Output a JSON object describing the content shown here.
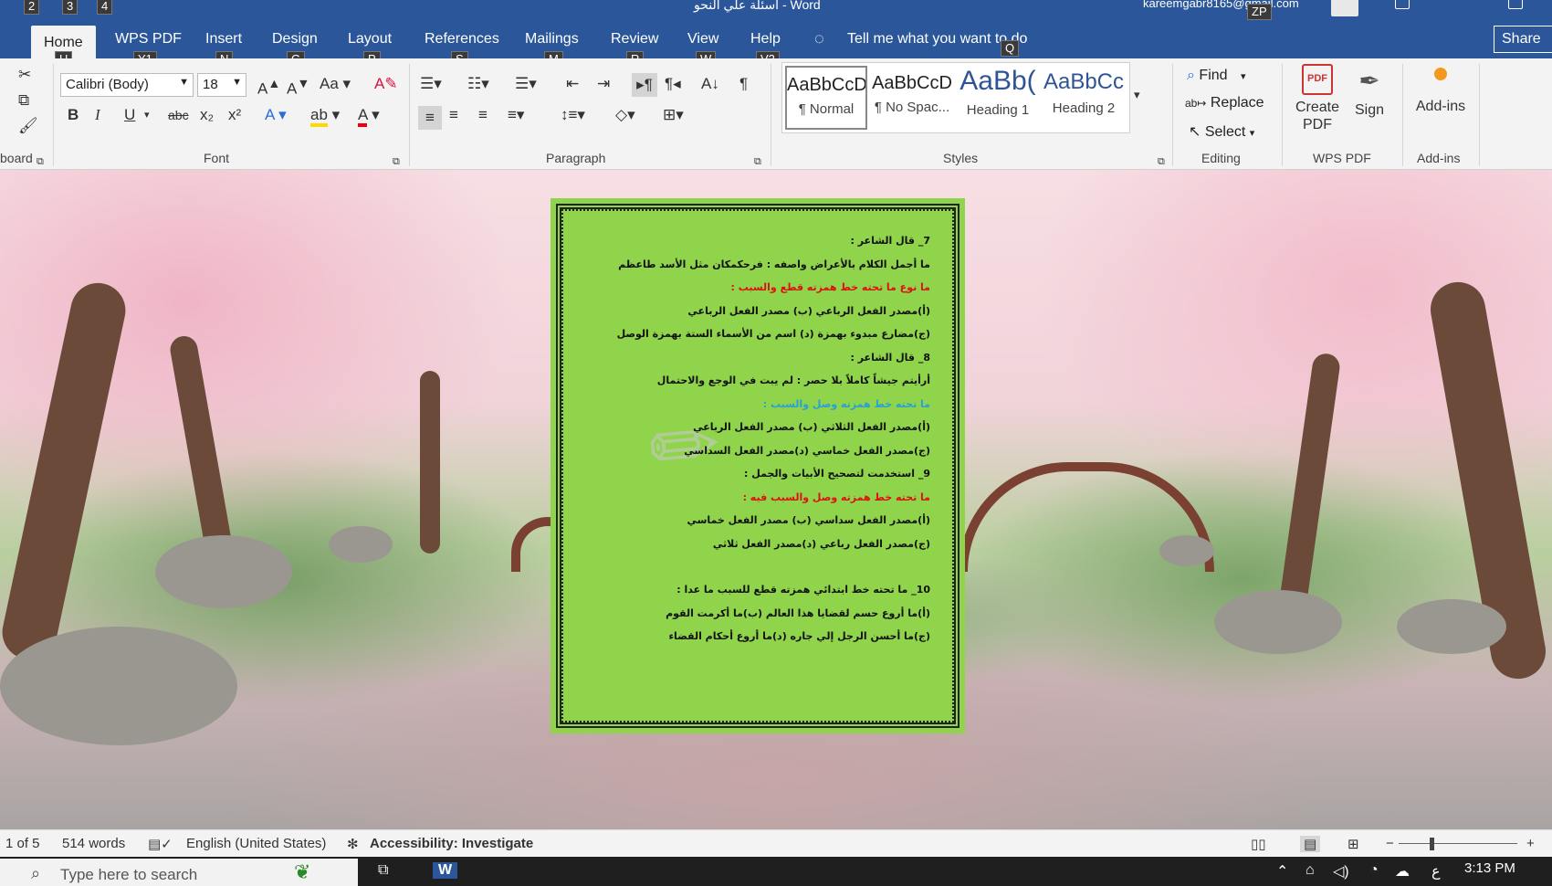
{
  "titlebar": {
    "title": "أسئلة علي النحو  -  Word",
    "account": "kareemgabr8165@gmail.com",
    "keytips": [
      "2",
      "3",
      "4",
      "ZP"
    ]
  },
  "tabs": {
    "items": [
      "Home",
      "WPS PDF",
      "Insert",
      "Design",
      "Layout",
      "References",
      "Mailings",
      "Review",
      "View",
      "Help"
    ],
    "keytips": [
      "H",
      "Y1",
      "N",
      "G",
      "P",
      "S",
      "M",
      "R",
      "W",
      "V2"
    ],
    "tellme": "Tell me what you want to do",
    "tellme_keytip": "Q",
    "share": "Share"
  },
  "ribbon": {
    "clipboard_label": "board",
    "font": {
      "label": "Font",
      "name": "Calibri (Body)",
      "size": "18",
      "bold": "B",
      "italic": "I",
      "underline": "U",
      "strike": "abc",
      "subscript": "x₂",
      "superscript": "x²",
      "change_case": "Aa"
    },
    "paragraph_label": "Paragraph",
    "styles": {
      "label": "Styles",
      "items": [
        {
          "preview": "AaBbCcD",
          "name": "¶ Normal"
        },
        {
          "preview": "AaBbCcD",
          "name": "¶ No Spac..."
        },
        {
          "preview": "AaBb(",
          "name": "Heading 1"
        },
        {
          "preview": "AaBbCc",
          "name": "Heading 2"
        }
      ]
    },
    "editing": {
      "label": "Editing",
      "find": "Find",
      "replace": "Replace",
      "select": "Select"
    },
    "wps": {
      "label": "WPS PDF",
      "create": "Create PDF",
      "sign": "Sign"
    },
    "addins": {
      "label": "Add-ins",
      "button": "Add-ins"
    }
  },
  "document": {
    "lines": [
      {
        "text": "7_ قال الشاعر :",
        "color": "black"
      },
      {
        "text": "ما أجمل الكلام بالأعراض واصفه : فرحكمكان مثل الأسد طاعظم",
        "color": "black"
      },
      {
        "text": "ما نوع ما تحته خط همزته قطع والسبب :",
        "color": "red"
      },
      {
        "text": "(أ)مصدر الفعل الرباعي     (ب) مصدر الفعل الرباعي",
        "color": "black"
      },
      {
        "text": "(ج)مضارع مبدوء بهمزة (د) اسم من الأسماء الستة بهمزة الوصل",
        "color": "black"
      },
      {
        "text": "8_ قال الشاعر :",
        "color": "black"
      },
      {
        "text": "أرأيتم جيشاً كاملاً بلا حصر : لم يبت في الوجع والاحتمال",
        "color": "black"
      },
      {
        "text": "ما تحته خط همزته وصل والسبب :",
        "color": "blue"
      },
      {
        "text": "(أ)مصدر الفعل الثلاثي   (ب) مصدر الفعل الرباعي",
        "color": "black"
      },
      {
        "text": "(ج)مصدر الفعل خماسي  (د)مصدر الفعل السداسي",
        "color": "black"
      },
      {
        "text": "9_ استخدمت لتصحيح الأبيات والجمل :",
        "color": "black"
      },
      {
        "text": "ما تحته خط همزته وصل والسبب فيه :",
        "color": "red"
      },
      {
        "text": "(أ)مصدر الفعل سداسي  (ب) مصدر الفعل خماسي",
        "color": "black"
      },
      {
        "text": "(ج)مصدر الفعل رباعي (د)مصدر الفعل ثلاثي",
        "color": "black"
      },
      {
        "text": "",
        "color": "gap"
      },
      {
        "text": "10_ ما تحته خط ابتدائي همزته قطع للسبب ما عدا :",
        "color": "black"
      },
      {
        "text": "(أ)ما أروع حسم لقضايا هذا العالم  (ب)ما أكرمت القوم",
        "color": "black"
      },
      {
        "text": "(ج)ما أحسن الرجل إلي جاره   (د)ما أروع أحكام القضاء",
        "color": "black"
      }
    ]
  },
  "status": {
    "page": "1 of 5",
    "words": "514 words",
    "language": "English (United States)",
    "accessibility": "Accessibility: Investigate"
  },
  "taskbar": {
    "search_placeholder": "Type here to search",
    "time": "3:13 PM"
  }
}
